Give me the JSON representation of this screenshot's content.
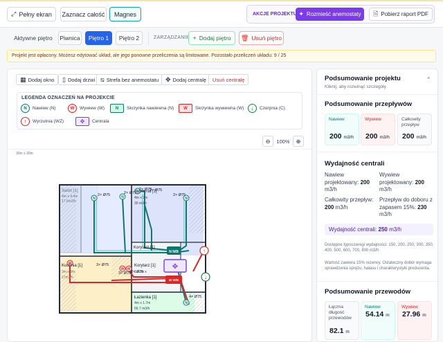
{
  "toolbar": {
    "fullscreen_label": "Pełny ekran",
    "select_all_label": "Zaznacz całość",
    "magnet_label": "Magnes"
  },
  "project_actions": {
    "group_label": "AKCJE PROJEKTU",
    "place_label": "Rozmieść anemostaty",
    "report_label": "Pobierz raport PDF"
  },
  "floors": {
    "active_label": "Aktywne piętro",
    "items": [
      "Piwnica",
      "Piętro 1",
      "Piętro 2"
    ],
    "active_index": 1
  },
  "management": {
    "label": "ZARZĄDZANIE",
    "add_label": "Dodaj piętro",
    "remove_label": "Usuń piętro"
  },
  "notice": "Projekt jest opłacony. Możesz edytować układ, ale jego ponowne przeliczenia są limitowane. Pozostało przeliczeń układu: 9 / 25",
  "tools": {
    "window": "Dodaj okno",
    "door": "Dodaj drzwi",
    "no_diffuser_zone": "Strefa bez anemostatu",
    "unit": "Dodaj centralę",
    "remove_unit": "Usuń centralę"
  },
  "legend": {
    "title": "LEGENDA OZNACZEŃ NA PROJEKCIE",
    "items": [
      {
        "sym": "N",
        "label": "Nawiew (N)"
      },
      {
        "sym": "W",
        "label": "Wywiew (W)"
      },
      {
        "sym": "N",
        "label": "Skrzynka nawiewna (N)"
      },
      {
        "sym": "W",
        "label": "Skrzynka wywiewna (W)"
      },
      {
        "sym": "↓",
        "label": "Czerpnia (C)"
      },
      {
        "sym": "↑",
        "label": "Wyrzutnia (WZ)"
      },
      {
        "sym": "✥",
        "label": "Centrala"
      }
    ]
  },
  "zoom": {
    "level": "100%"
  },
  "drawing": {
    "dimension": "30m x 30m",
    "rooms": [
      {
        "name": "Salon [1]",
        "size": "4m x 4.4m",
        "area": "17.6m3/h"
      },
      {
        "name": "Sypialnia [1]",
        "size": "4m x 3m",
        "area": "30 m3/h"
      },
      {
        "name": "Korytarz [1]",
        "size": "",
        "area": ""
      },
      {
        "name": "Korytarz [1]",
        "size": "1.42m x",
        "area": ""
      },
      {
        "name": "Kuchnia [1]",
        "size": "3m x 3m",
        "area": "27m3/h"
      },
      {
        "name": "Łazienka [1]",
        "size": "4m x 1.7m",
        "area": "66.7 m3/h"
      }
    ],
    "duct_labels": [
      "2× Ø75",
      "2× Ø75",
      "2× Ø75",
      "2× Ø75",
      "2× Ø75",
      "3× Ø75",
      "2× Ø75",
      "3× Ø75",
      "4× Ø75"
    ],
    "manifold_labels": {
      "supply": "N N/B",
      "exhaust": "W W/B"
    }
  },
  "summary": {
    "title": "Podsumowanie projektu",
    "subtitle": "Kliknij, aby rozwinąć szczegóły",
    "airflow": {
      "title": "Podsumowanie przepływów",
      "cards": [
        {
          "label": "Nawiew",
          "value": "200",
          "unit": "m3/h"
        },
        {
          "label": "Wywiew",
          "value": "200",
          "unit": "m3/h"
        },
        {
          "label": "Całkowity przepływ",
          "value": "200",
          "unit": "m3/h"
        }
      ]
    },
    "unit_capacity": {
      "title": "Wydajność centrali",
      "supply_label": "Nawiew projektowany:",
      "supply_value": "200",
      "supply_unit": "m3/h",
      "exhaust_label": "Wywiew projektowany:",
      "exhaust_value": "200",
      "exhaust_unit": "m3/h",
      "total_label": "Całkowity przepływ:",
      "total_value": "200",
      "total_unit": "m3/h",
      "reserve_label": "Przepływ do doboru z zapasem 15%:",
      "reserve_value": "230",
      "reserve_unit": "m3/h",
      "result_label": "Wydajność centrali:",
      "result_value": "250",
      "result_unit": "m3/h",
      "note1": "Dostępne typoszeregi wydajności: 150, 200, 250, 300, 350, 400, 500, 600, 700, 800 m3/h",
      "note2": "Wartość zawiera 15% rezerwy. Ostateczny dobór wymaga sprawdzenia sprężu, hałasu i charakterystyki producenta."
    },
    "ducts": {
      "title": "Podsumowanie przewodów",
      "cards": [
        {
          "label": "Łączna długość przewodów",
          "value": "82.1",
          "unit": "m"
        },
        {
          "label": "Nawiew",
          "value": "54.14",
          "unit": "m"
        },
        {
          "label": "Wywiew",
          "value": "27.96",
          "unit": "m"
        }
      ]
    }
  },
  "colors": {
    "accent": "#7c3aed",
    "primary": "#2563eb",
    "supply": "#0f766e",
    "exhaust": "#dc2626",
    "danger": "#dc2626",
    "success": "#16a34a"
  }
}
